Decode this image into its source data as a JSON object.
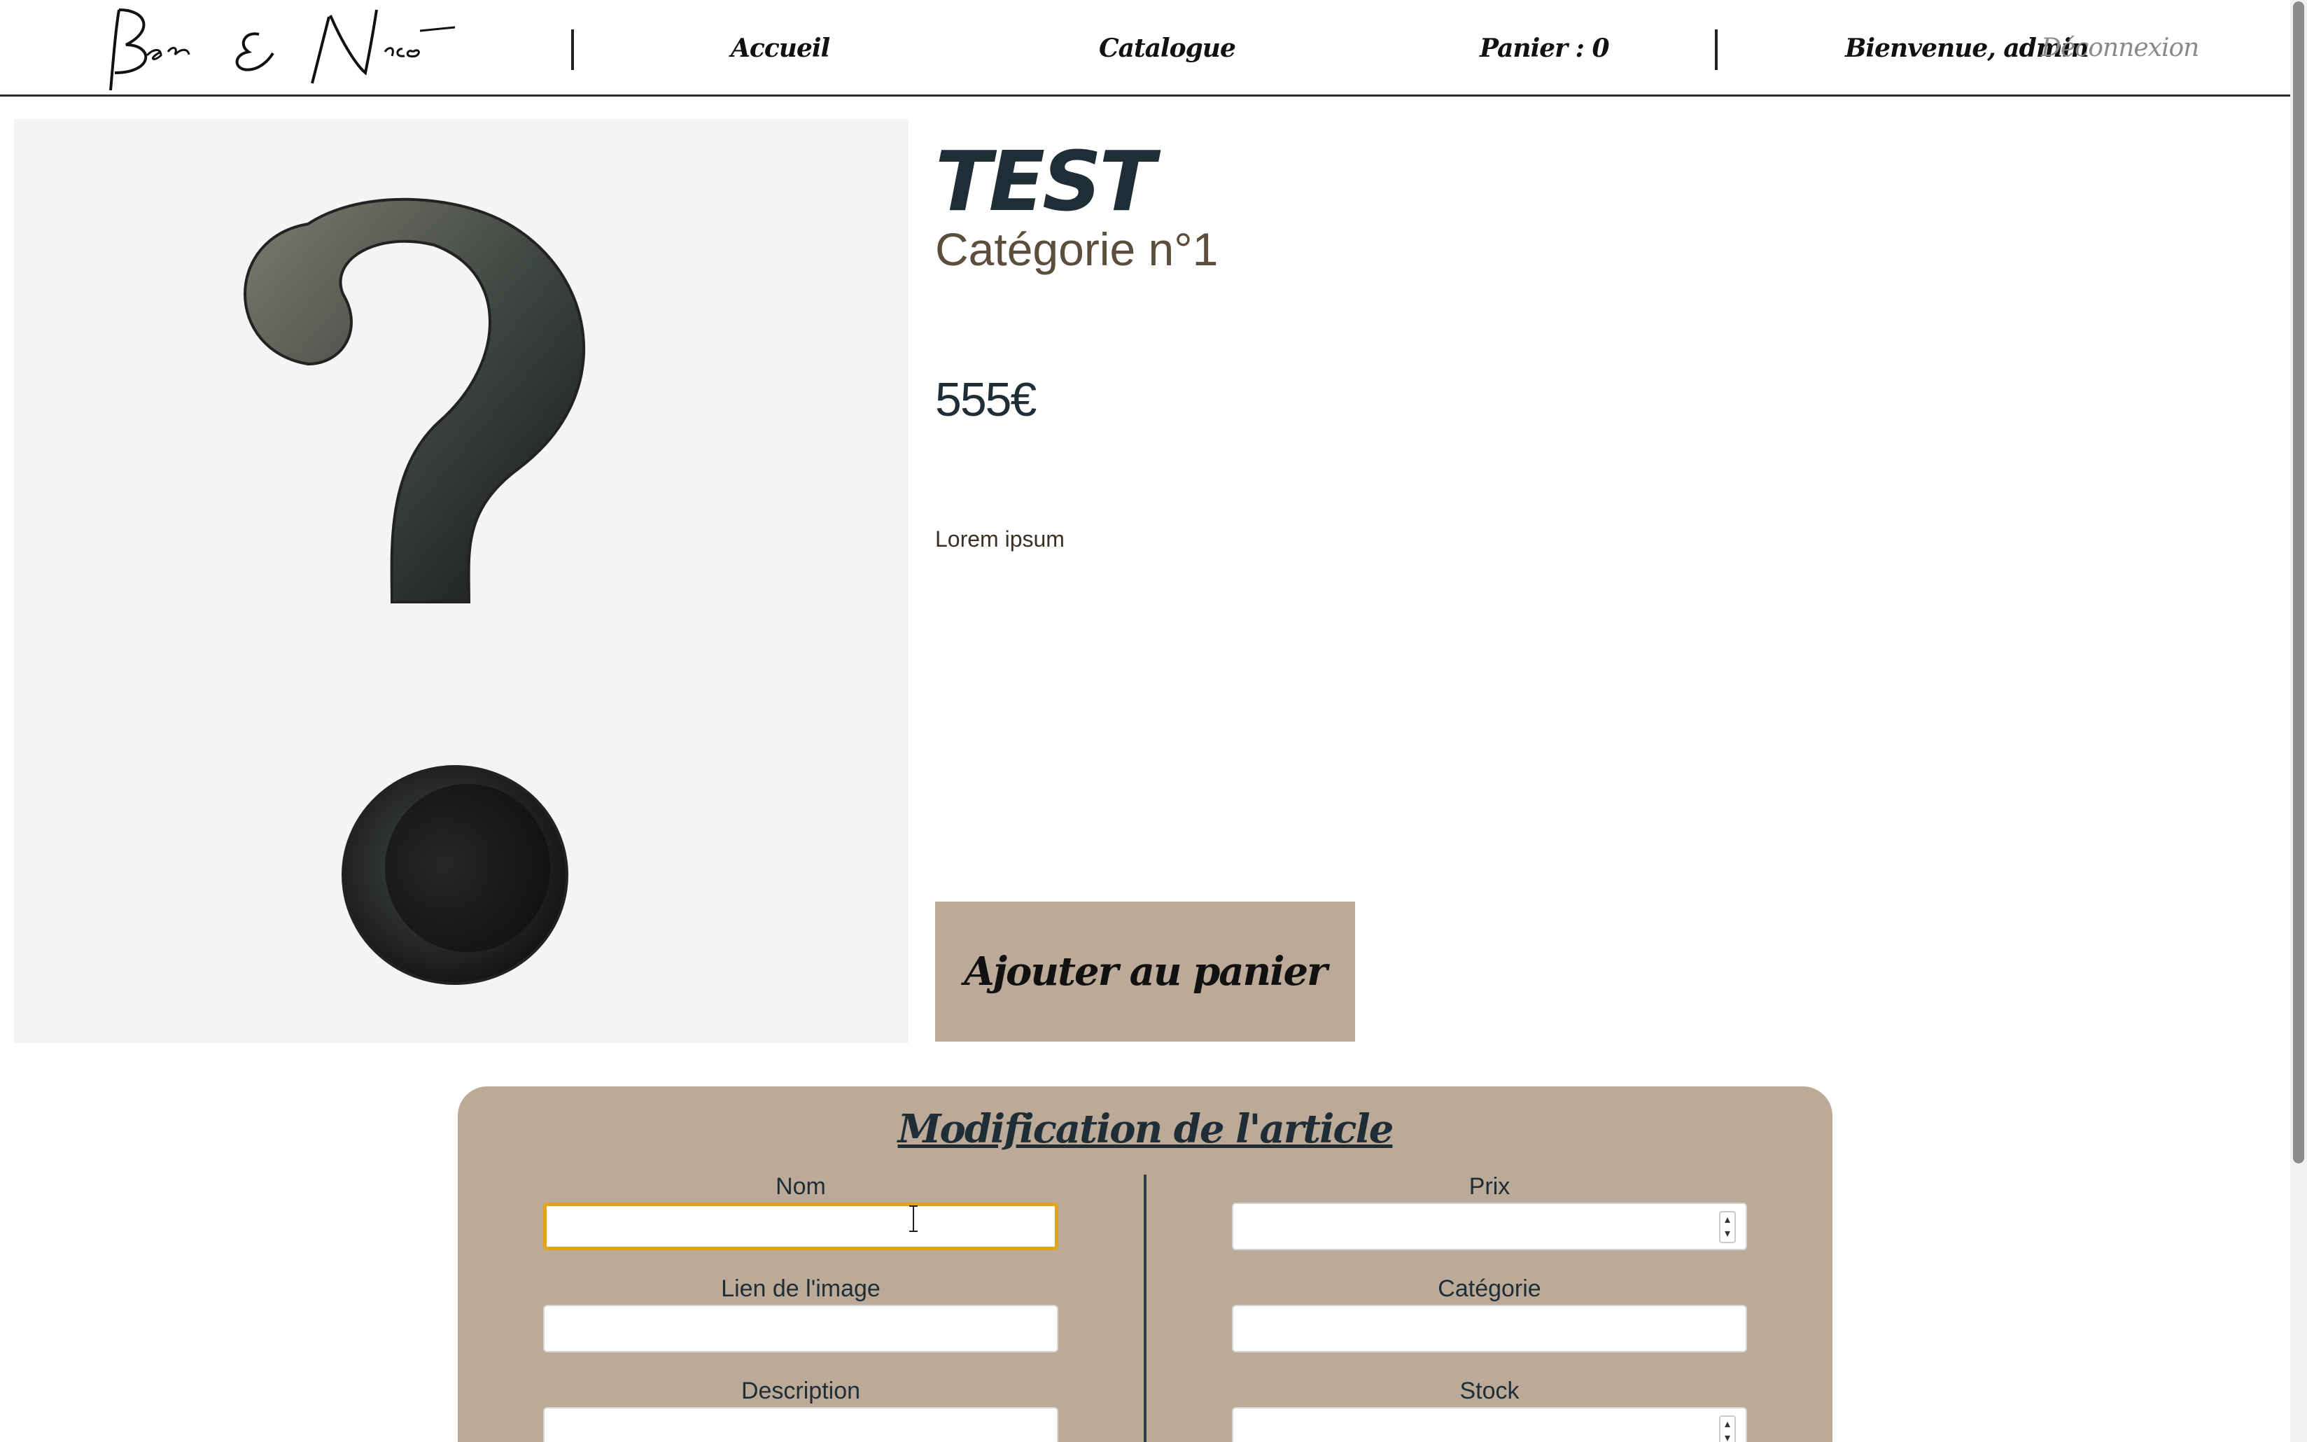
{
  "navbar": {
    "logo_text": "Ben & Nico",
    "links": {
      "home": "Accueil",
      "catalog": "Catalogue",
      "cart": "Panier : 0",
      "welcome": "Bienvenue, admin",
      "logout": "Déconnexion"
    }
  },
  "product": {
    "image_icon": "question-mark-image",
    "title": "TEST",
    "category": "Catégorie n°1",
    "price": "555€",
    "description": "Lorem ipsum",
    "add_to_cart_label": "Ajouter au panier"
  },
  "edit_form": {
    "title": "Modification de l'article",
    "fields": {
      "name": {
        "label": "Nom",
        "value": ""
      },
      "image_link": {
        "label": "Lien de l'image",
        "value": ""
      },
      "description": {
        "label": "Description",
        "value": ""
      },
      "price": {
        "label": "Prix",
        "value": ""
      },
      "category": {
        "label": "Catégorie",
        "value": ""
      },
      "stock": {
        "label": "Stock",
        "value": ""
      }
    }
  },
  "colors": {
    "accent_beige": "#bcaa98",
    "text_dark": "#1f2d36",
    "category_brown": "#5c4d3d",
    "focus_border": "#e0a41a"
  }
}
